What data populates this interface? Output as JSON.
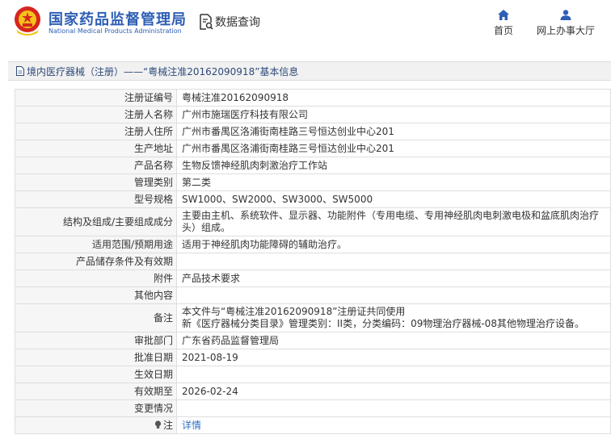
{
  "header": {
    "org_cn": "国家药品监督管理局",
    "org_en": "National Medical Products Administration",
    "query_label": "数据查询",
    "nav": {
      "home_label": "首页",
      "service_label": "网上办事大厅"
    }
  },
  "title_bar": {
    "text": "境内医疗器械（注册）——“粤械注准20162090918”基本信息"
  },
  "rows": [
    {
      "label": "注册证编号",
      "value": "粤械注准20162090918"
    },
    {
      "label": "注册人名称",
      "value": "广州市施瑞医疗科技有限公司"
    },
    {
      "label": "注册人住所",
      "value": "广州市番禺区洛浦街南桂路三号恒达创业中心201"
    },
    {
      "label": "生产地址",
      "value": "广州市番禺区洛浦街南桂路三号恒达创业中心201"
    },
    {
      "label": "产品名称",
      "value": "生物反馈神经肌肉刺激治疗工作站"
    },
    {
      "label": "管理类别",
      "value": "第二类"
    },
    {
      "label": "型号规格",
      "value": "SW1000、SW2000、SW3000、SW5000"
    },
    {
      "label": "结构及组成/主要组成成分",
      "value": "主要由主机、系统软件、显示器、功能附件（专用电缆、专用神经肌肉电刺激电极和盆底肌肉治疗头）组成。"
    },
    {
      "label": "适用范围/预期用途",
      "value": "适用于神经肌肉功能障碍的辅助治疗。"
    },
    {
      "label": "产品储存条件及有效期",
      "value": ""
    },
    {
      "label": "附件",
      "value": "产品技术要求"
    },
    {
      "label": "其他内容",
      "value": ""
    },
    {
      "label": "备注",
      "value_line1": "本文件与“粤械注准20162090918”注册证共同使用",
      "value_line2": "新《医疗器械分类目录》管理类别：II类，分类编码：09物理治疗器械-08其他物理治疗设备。"
    },
    {
      "label": "审批部门",
      "value": "广东省药品监督管理局"
    },
    {
      "label": "批准日期",
      "value": "2021-08-19"
    },
    {
      "label": "生效日期",
      "value": ""
    },
    {
      "label": "有效期至",
      "value": "2026-02-24"
    },
    {
      "label": "变更情况",
      "value": ""
    },
    {
      "label": "注",
      "value": "详情"
    }
  ],
  "colors": {
    "brand_blue": "#2e5fb5",
    "emblem_red": "#d7261e",
    "link_blue": "#2e6fc9"
  },
  "icons": [
    "national-emblem-icon",
    "document-search-icon",
    "home-icon",
    "user-icon",
    "document-icon",
    "lightbulb-icon"
  ]
}
